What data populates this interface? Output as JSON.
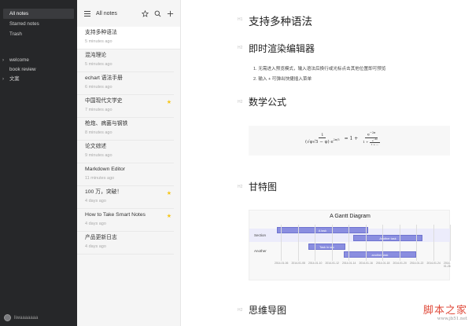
{
  "sidebar": {
    "nav": [
      "All notes",
      "Starred notes",
      "Trash"
    ],
    "folders": [
      {
        "label": "welcome",
        "chevron": "›",
        "sub": false
      },
      {
        "label": "book review",
        "chevron": "",
        "sub": true
      },
      {
        "label": "文案",
        "chevron": "›",
        "sub": false
      }
    ],
    "username": "liwaaaaaaa"
  },
  "list": {
    "title": "All notes",
    "notes": [
      {
        "title": "支持多种语法",
        "time": "5 minutes ago",
        "starred": false
      },
      {
        "title": "混沌理论",
        "time": "5 minutes ago",
        "starred": false
      },
      {
        "title": "echart 语法手册",
        "time": "6 minutes ago",
        "starred": false
      },
      {
        "title": "中国现代文学史",
        "time": "7 minutes ago",
        "starred": true
      },
      {
        "title": "枪炮、病菌与钢铁",
        "time": "8 minutes ago",
        "starred": false
      },
      {
        "title": "论文综述",
        "time": "9 minutes ago",
        "starred": false
      },
      {
        "title": "Markdown Editor",
        "time": "11 minutes ago",
        "starred": false
      },
      {
        "title": "100 万，突破！",
        "time": "4 days ago",
        "starred": true
      },
      {
        "title": "How to Take Smart Notes",
        "time": "4 days ago",
        "starred": true
      },
      {
        "title": "产品更新日志",
        "time": "4 days ago",
        "starred": false
      }
    ]
  },
  "editor": {
    "h1": "支持多种语法",
    "h1_mark": "H1",
    "h2_mark": "H2",
    "live_heading": "即时渲染编辑器",
    "list_items": [
      "1. 无需进入预览模式，输入语法后换行或光标点击其他位置即可预览",
      "2. 输入 + 可弹出快捷插入菜单"
    ],
    "math_heading": "数学公式",
    "gantt_heading": "甘特图",
    "mindmap_heading": "思维导图",
    "gantt": {
      "title": "A Gantt Diagram",
      "sections": [
        "Section",
        "Another"
      ],
      "tasks": [
        "A task",
        "Another task",
        "Task in sec",
        "another task"
      ],
      "dates": [
        "2014-01-06",
        "2014-01-08",
        "2014-01-10",
        "2014-01-12",
        "2014-01-14",
        "2014-01-16",
        "2014-01-18",
        "2014-01-20",
        "2014-01-22",
        "2014-01-24",
        "2014-01-26"
      ]
    }
  },
  "watermark": {
    "top": "脚本之家",
    "bottom": "www.jb51.net"
  },
  "colors": {
    "sidebar": "#262729",
    "list": "#f5f5f5",
    "star": "#f5c518",
    "gantt_bar": "#8a8ee0",
    "watermark": "#e04a3a"
  }
}
